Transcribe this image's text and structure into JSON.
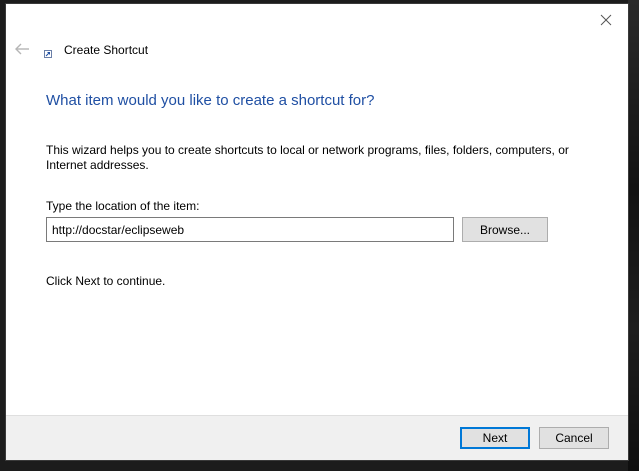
{
  "window": {
    "title": "Create Shortcut",
    "close_icon": "close-icon",
    "back_icon": "back-arrow-icon",
    "title_icon": "shortcut-icon"
  },
  "main": {
    "heading": "What item would you like to create a shortcut for?",
    "description": "This wizard helps you to create shortcuts to local or network programs, files, folders, computers, or Internet addresses.",
    "location_label": "Type the location of the item:",
    "location_value": "http://docstar/eclipseweb",
    "browse_label": "Browse...",
    "continue_text": "Click Next to continue."
  },
  "footer": {
    "next_label": "Next",
    "cancel_label": "Cancel"
  },
  "colors": {
    "heading": "#1f4fa3",
    "default_button_border": "#0078d7",
    "footer_bg": "#f0f0f0"
  }
}
